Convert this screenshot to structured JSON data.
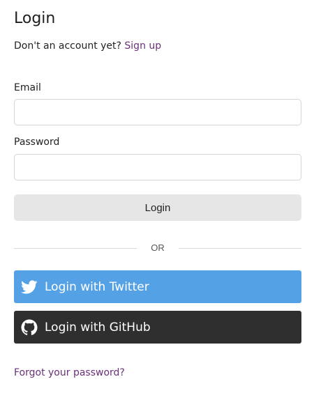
{
  "header": {
    "title": "Login"
  },
  "signup": {
    "prompt": "Don't an account yet?",
    "link_label": "Sign up"
  },
  "form": {
    "email_label": "Email",
    "email_value": "",
    "password_label": "Password",
    "password_value": "",
    "login_label": "Login"
  },
  "divider": {
    "label": "OR"
  },
  "social": {
    "twitter_label": "Login with Twitter",
    "twitter_icon": "twitter-bird-icon",
    "twitter_color": "#55a1e6",
    "github_label": "Login with GitHub",
    "github_icon": "github-octocat-icon",
    "github_color": "#2f2f2f"
  },
  "footer": {
    "forgot_label": "Forgot your password?"
  },
  "colors": {
    "link": "#6a2f7a",
    "login_button_bg": "#e6e6e6"
  }
}
